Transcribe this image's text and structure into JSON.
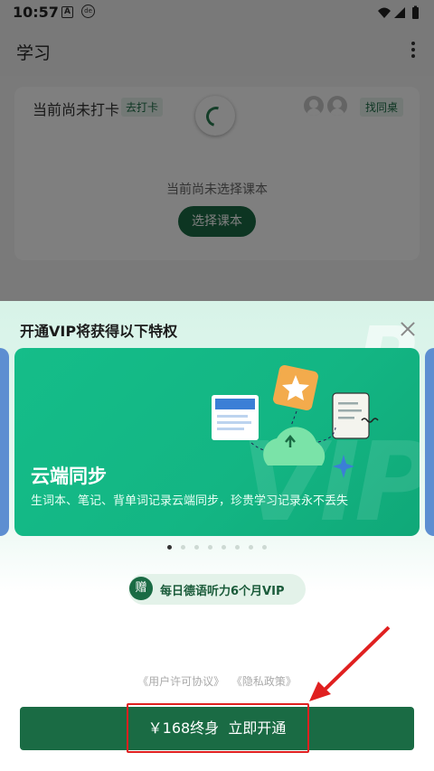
{
  "status_bar": {
    "time": "10:57",
    "icon1": "A",
    "icon2": "de"
  },
  "app_bar": {
    "title": "学习",
    "more_icon": "more-vertical-icon"
  },
  "study_card": {
    "checkin_text": "当前尚未打卡",
    "go_checkin": "去打卡",
    "find_deskmate": "找同桌",
    "no_course_text": "当前尚未选择课本",
    "choose_course": "选择课本"
  },
  "vip_sheet": {
    "title": "开通VIP将获得以下特权",
    "banner": {
      "title": "云端同步",
      "subtitle": "生词本、笔记、背单词记录云端同步，珍贵学习记录永不丢失",
      "watermark": "VIP"
    },
    "carousel": {
      "total": 8,
      "active": 0
    },
    "gift": {
      "badge": "赠",
      "text": "每日德语听力6个月VIP"
    },
    "agreements": {
      "user_agreement": "《用户许可协议》",
      "privacy": "《隐私政策》"
    },
    "buy_button": "￥168终身  立即开通"
  },
  "colors": {
    "brand": "#1a6b44",
    "banner": "#13b583",
    "highlight": "#e02020"
  }
}
